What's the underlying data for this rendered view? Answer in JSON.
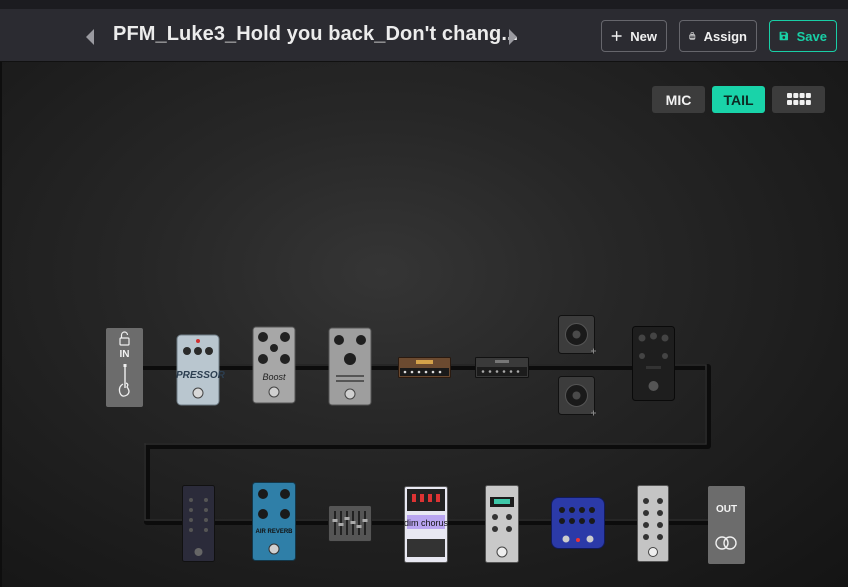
{
  "header": {
    "preset_title": "PFM_Luke3_Hold you back_Don't chang...",
    "prev_icon": "caret-left-icon",
    "next_icon": "caret-right-icon"
  },
  "toolbar": {
    "new_label": "New",
    "assign_label": "Assign",
    "save_label": "Save",
    "accent_color": "#19cfa6"
  },
  "view_toggle": {
    "mic_label": "MIC",
    "tail_label": "TAIL",
    "selected": "TAIL",
    "grid_icon": "grid-icon"
  },
  "signal_chain": {
    "input_label": "IN",
    "output_label": "OUT",
    "row1": [
      "compressor",
      "boost",
      "stereo-doubler",
      "amp-head-1",
      "amp-head-2",
      "cab-top",
      "cab-bottom",
      "pre-eq"
    ],
    "row2": [
      "eq-pedal",
      "reverb-blue",
      "graphic-eq",
      "dim-chorus",
      "reverb-silver",
      "delay-blue",
      "multi-knob-pedal"
    ],
    "pedal_labels": {
      "compressor": "PRESSOR",
      "boost": "Boost",
      "reverb_blue": "AIR REVERB",
      "chorus": "dim chorus"
    }
  }
}
